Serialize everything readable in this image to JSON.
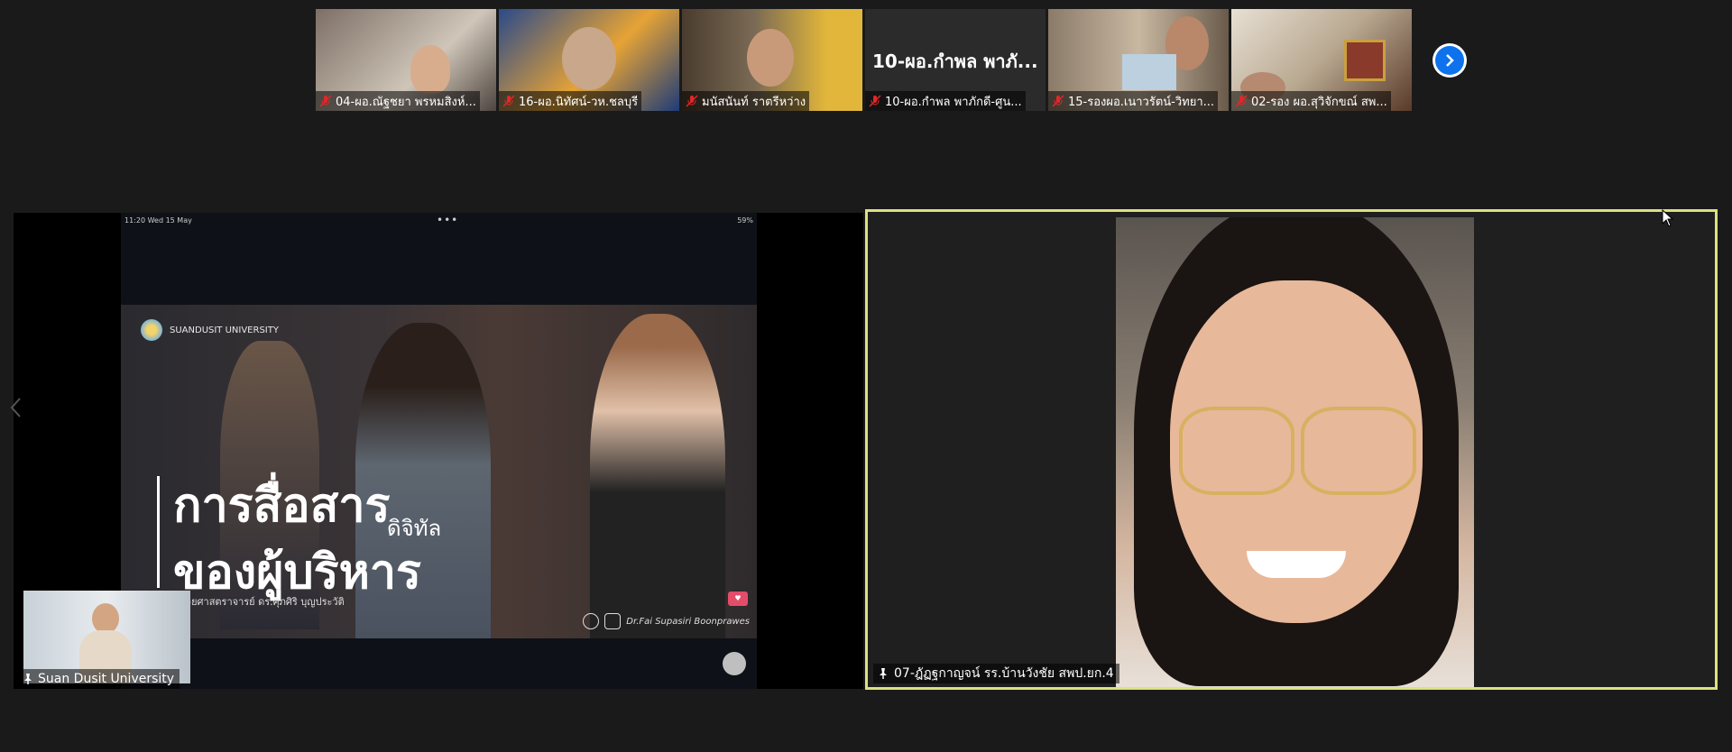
{
  "gallery": {
    "participants": [
      {
        "name": "04-ผอ.ณัฐชยา พรหมสิงห์...",
        "muted": true
      },
      {
        "name": "16-ผอ.นิทัศน์-วห.ชลบุรี",
        "muted": true
      },
      {
        "name": "มนัสนันท์ ราตรีหว่าง",
        "muted": true
      },
      {
        "name": "10-ผอ.กำพล พาภักดี-ศูน...",
        "muted": true,
        "video_off_name": "10-ผอ.กำพล พาภั..."
      },
      {
        "name": "15-รองผอ.เนาวรัตน์-วิทยา...",
        "muted": true
      },
      {
        "name": "02-รอง ผอ.สุวิจักขณ์ สพ...",
        "muted": true
      }
    ]
  },
  "share": {
    "status_time": "11:20  Wed 15 May",
    "status_battery": "59%",
    "slide": {
      "brand": "SUANDUSIT UNIVERSITY",
      "title_line1": "การสื่อสาร",
      "title_small": "ดิจิทัล",
      "title_line2": "ของผู้บริหาร",
      "credit": "ผู้ช่วยศาสตราจารย์ ดร.ศุภศิริ บุญประวัติ",
      "social_handle": "Dr.Fai Supasiri Boonprawes"
    },
    "presenter_name": "Suan Dusit University"
  },
  "speaker": {
    "name": "07-ฎัฏฐกาญจน์ รร.บ้านวังชัย สพป.ยก.4"
  },
  "colors": {
    "background": "#1a1a1a",
    "active_border": "#dce080",
    "accent_blue": "#0e72ed",
    "muted_red": "#e02828"
  }
}
